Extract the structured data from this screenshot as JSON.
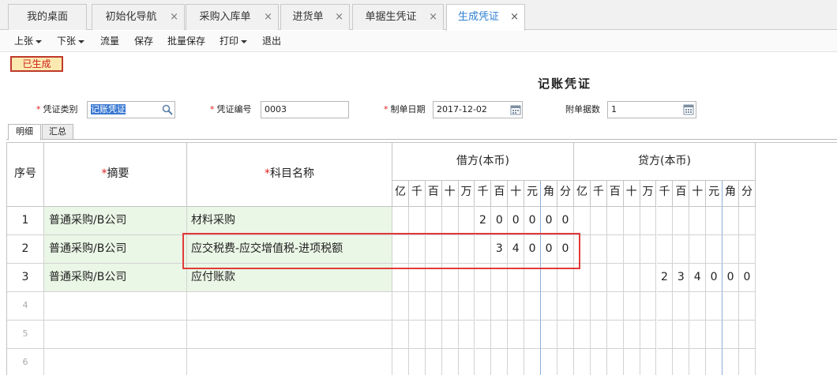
{
  "tabs": [
    {
      "label": "我的桌面",
      "closable": false
    },
    {
      "label": "初始化导航",
      "closable": true
    },
    {
      "label": "采购入库单",
      "closable": true
    },
    {
      "label": "进货单",
      "closable": true
    },
    {
      "label": "单据生凭证",
      "closable": true
    },
    {
      "label": "生成凭证",
      "closable": true,
      "active": true
    }
  ],
  "close_glyph": "×",
  "toolbar": {
    "prev": "上张",
    "next": "下张",
    "flow": "流量",
    "save": "保存",
    "batch_save": "批量保存",
    "print": "打印",
    "exit": "退出"
  },
  "status_badge": "已生成",
  "voucher_title": "记账凭证",
  "form": {
    "required_mark": "*",
    "type_label": "凭证类别",
    "type_value": "记账凭证",
    "number_label": "凭证编号",
    "number_value": "0003",
    "date_label": "制单日期",
    "date_value": "2017-12-02",
    "attach_label": "附单据数",
    "attach_value": "1"
  },
  "subtabs": {
    "detail": "明细",
    "summary": "汇总"
  },
  "grid": {
    "col_seq": "序号",
    "col_summary": "摘要",
    "col_account": "科目名称",
    "col_debit": "借方(本币)",
    "col_credit": "贷方(本币)",
    "digit_units": [
      "亿",
      "千",
      "百",
      "十",
      "万",
      "千",
      "百",
      "十",
      "元",
      "角",
      "分"
    ],
    "rows": [
      {
        "no": "1",
        "summary": "普通采购/B公司",
        "account": "材料采购",
        "debit": [
          "",
          "",
          "",
          "",
          "",
          "2",
          "0",
          "0",
          "0",
          "0",
          "0"
        ],
        "credit": [
          "",
          "",
          "",
          "",
          "",
          "",
          "",
          "",
          "",
          "",
          ""
        ]
      },
      {
        "no": "2",
        "summary": "普通采购/B公司",
        "account": "应交税费-应交增值税-进项税额",
        "debit": [
          "",
          "",
          "",
          "",
          "",
          "",
          "3",
          "4",
          "0",
          "0",
          "0"
        ],
        "credit": [
          "",
          "",
          "",
          "",
          "",
          "",
          "",
          "",
          "",
          "",
          ""
        ]
      },
      {
        "no": "3",
        "summary": "普通采购/B公司",
        "account": "应付账款",
        "debit": [
          "",
          "",
          "",
          "",
          "",
          "",
          "",
          "",
          "",
          "",
          ""
        ],
        "credit": [
          "",
          "",
          "",
          "",
          "",
          "2",
          "3",
          "4",
          "0",
          "0",
          "0"
        ]
      },
      {
        "no": "4",
        "summary": "",
        "account": "",
        "debit": [
          "",
          "",
          "",
          "",
          "",
          "",
          "",
          "",
          "",
          "",
          ""
        ],
        "credit": [
          "",
          "",
          "",
          "",
          "",
          "",
          "",
          "",
          "",
          "",
          ""
        ]
      },
      {
        "no": "5",
        "summary": "",
        "account": "",
        "debit": [
          "",
          "",
          "",
          "",
          "",
          "",
          "",
          "",
          "",
          "",
          ""
        ],
        "credit": [
          "",
          "",
          "",
          "",
          "",
          "",
          "",
          "",
          "",
          "",
          ""
        ]
      },
      {
        "no": "6",
        "summary": "",
        "account": "",
        "debit": [
          "",
          "",
          "",
          "",
          "",
          "",
          "",
          "",
          "",
          "",
          ""
        ],
        "credit": [
          "",
          "",
          "",
          "",
          "",
          "",
          "",
          "",
          "",
          "",
          ""
        ]
      }
    ]
  },
  "colors": {
    "accent": "#2c7fd1",
    "badge_border": "#c0392b",
    "highlight": "#e23a3a",
    "green_cell": "#eaf6e6"
  }
}
